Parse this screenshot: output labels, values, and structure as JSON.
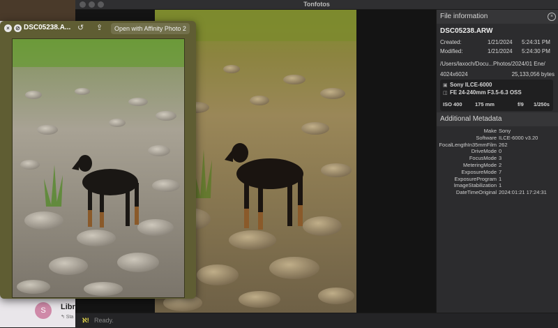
{
  "app": {
    "title": "Tonfotos"
  },
  "quicklook": {
    "filename": "DSC05238.A...",
    "open_with_label": "Open with Affinity Photo 2",
    "close_symbol": "×",
    "fullscreen_symbol": "⊘",
    "rotate_symbol": "↺",
    "share_symbol": "⇪"
  },
  "background_window": {
    "avatar_letter": "S",
    "item_title": "Libr",
    "item_subtitle": "↰ Sta"
  },
  "file_info": {
    "section_title": "File information",
    "close_symbol": "×",
    "filename": "DSC05238.ARW",
    "created_label": "Created:",
    "created_date": "1/21/2024",
    "created_time": "5:24:31 PM",
    "modified_label": "Modified:",
    "modified_date": "1/21/2024",
    "modified_time": "5:24:30 PM",
    "path": "/Users/laxoch/Docu...Photos/2024/01 Ene/",
    "dimensions": "4024x6024",
    "size": "25,133,056 bytes",
    "camera": "Sony ILCE-6000",
    "lens": "FE 24-240mm F3.5-6.3 OSS",
    "iso": "ISO 400",
    "focal": "175 mm",
    "aperture": "f/9",
    "shutter": "1/250s"
  },
  "additional_metadata": {
    "section_title": "Additional Metadata",
    "rows": [
      {
        "key": "Make",
        "value": "Sony"
      },
      {
        "key": "Software",
        "value": "ILCE-6000 v3.20"
      },
      {
        "key": "FocalLengthIn35mmFilm",
        "value": "262"
      },
      {
        "key": "DriveMode",
        "value": "0"
      },
      {
        "key": "FocusMode",
        "value": "3"
      },
      {
        "key": "MeteringMode",
        "value": "2"
      },
      {
        "key": "ExposureMode",
        "value": "7"
      },
      {
        "key": "ExposureProgram",
        "value": "1"
      },
      {
        "key": "ImageStabilization",
        "value": "1"
      },
      {
        "key": "DateTimeOriginal",
        "value": "2024:01:21 17:24:31"
      }
    ]
  },
  "status": {
    "text": "Ready.",
    "icon_text": "ℵ!"
  },
  "colors": {
    "window_bg": "#262628",
    "panel_bg": "#2c2c2e",
    "section_bg": "#363638",
    "quicklook_bg": "#5f5d33",
    "avatar_bg": "#cf89a8"
  }
}
